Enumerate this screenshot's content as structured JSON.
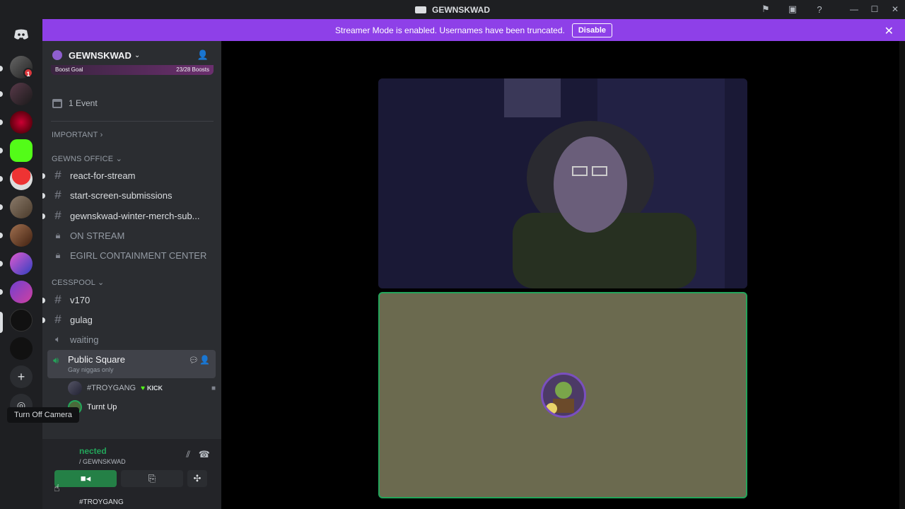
{
  "window": {
    "title": "GEWNSKWAD",
    "controls": [
      "—",
      "☐",
      "✕"
    ]
  },
  "banner": {
    "message": "Streamer Mode is enabled. Usernames have been truncated.",
    "button_label": "Disable",
    "color": "#8e40e8"
  },
  "server": {
    "name": "GEWNSKWAD",
    "boost_goal_label": "Boost Goal",
    "boost_progress": "23/28 Boosts",
    "events": "1 Event"
  },
  "categories": {
    "important": "IMPORTANT",
    "gewns_office": "GEWNS OFFICE",
    "cesspool": "CESSPOOL"
  },
  "channels": {
    "react_for_stream": "react-for-stream",
    "start_screen_submissions": "start-screen-submissions",
    "winter_merch": "gewnskwad-winter-merch-sub...",
    "on_stream": "ON STREAM",
    "egirl_containment": "EGIRL CONTAINMENT CENTER",
    "v170": "v170",
    "gulag": "gulag",
    "waiting": "waiting",
    "public_square": "Public Square",
    "public_square_status": "Gay niggas only"
  },
  "voice_users": [
    {
      "name": "#TROYGANG",
      "tag": "KICK"
    },
    {
      "name": "Turnt Up"
    }
  ],
  "voice_panel": {
    "connected": "nected",
    "location": "/ GEWNSKWAD",
    "tooltip": "Turn Off Camera",
    "user_strip": "#TROYGANG"
  },
  "rail": {
    "unread_badge": "1"
  },
  "colors": {
    "accent_green": "#23a55a",
    "sidebar_bg": "#2b2d31",
    "rail_bg": "#1e1f22"
  }
}
